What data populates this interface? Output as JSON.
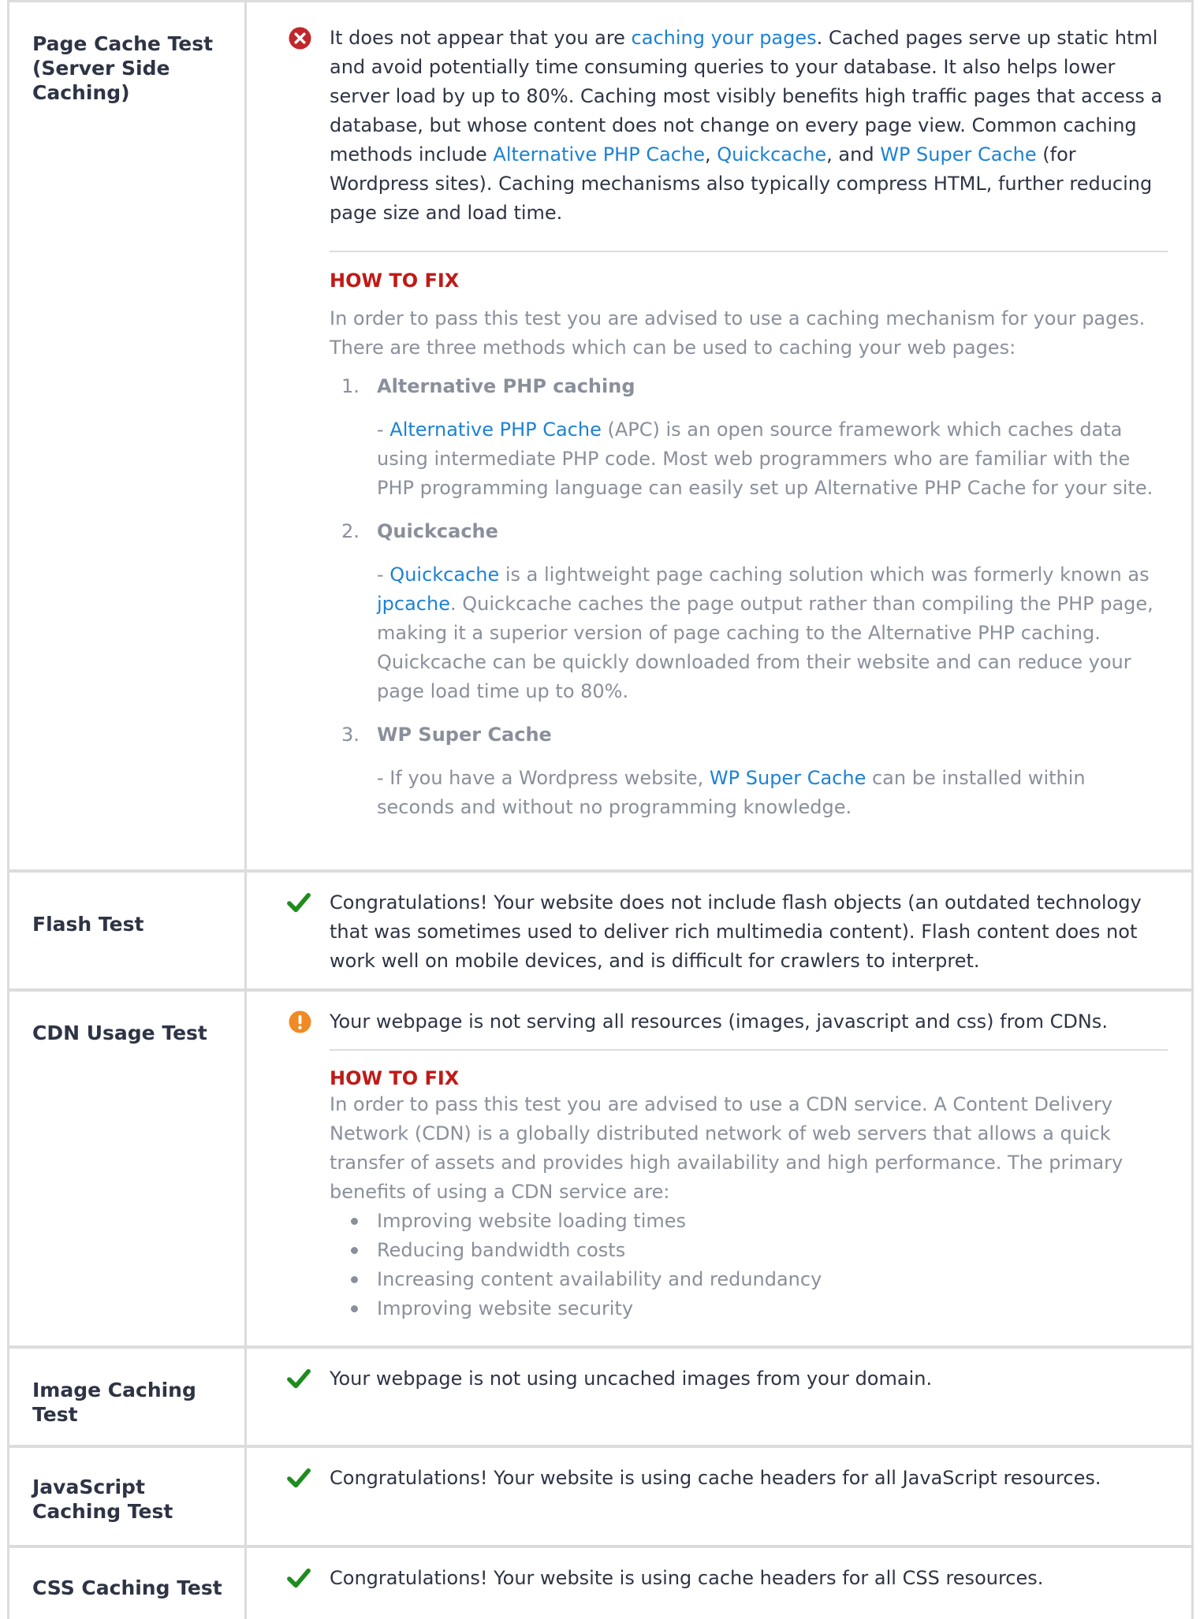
{
  "rows": [
    {
      "label": "Page Cache Test (Server Side Caching)",
      "status": "fail",
      "message": {
        "p1": "It does not appear that you are ",
        "link1": "caching your pages",
        "p2": ". Cached pages serve up static html and avoid potentially time consuming queries to your database. It also helps lower server load by up to 80%. Caching most visibly benefits high traffic pages that access a database, but whose content does not change on every page view. Common caching methods include ",
        "link2": "Alternative PHP Cache",
        "p3": ", ",
        "link3": "Quickcache",
        "p4": ", and ",
        "link4": "WP Super Cache",
        "p5": " (for Wordpress sites). Caching mechanisms also typically compress HTML, further reducing page size and load time."
      },
      "how_to_fix": {
        "heading": "HOW TO FIX",
        "intro": "In order to pass this test you are advised to use a caching mechanism for your pages. There are three methods which can be used to caching your web pages:",
        "methods": [
          {
            "number": "1.",
            "title": "Alternative PHP caching",
            "prefix": "- ",
            "link": "Alternative PHP Cache",
            "text": " (APC) is an open source framework which caches data using intermediate PHP code. Most web programmers who are familiar with the PHP programming language can easily set up Alternative PHP Cache for your site."
          },
          {
            "number": "2.",
            "title": "Quickcache",
            "prefix": "- ",
            "link": "Quickcache",
            "mid": " is a lightweight page caching solution which was formerly known as ",
            "link2": "jpcache",
            "text": ". Quickcache caches the page output rather than compiling the PHP page, making it a superior version of page caching to the Alternative PHP caching. Quickcache can be quickly downloaded from their website and can reduce your page load time up to 80%."
          },
          {
            "number": "3.",
            "title": "WP Super Cache",
            "prefix": "- If you have a Wordpress website, ",
            "link": "WP Super Cache",
            "text": " can be installed within seconds and without no programming knowledge."
          }
        ]
      }
    },
    {
      "label": "Flash Test",
      "status": "pass",
      "message": "Congratulations! Your website does not include flash objects (an outdated technology that was sometimes used to deliver rich multimedia content). Flash content does not work well on mobile devices, and is difficult for crawlers to interpret."
    },
    {
      "label": "CDN Usage Test",
      "status": "warning",
      "message": "Your webpage is not serving all resources (images, javascript and css) from CDNs.",
      "how_to_fix": {
        "heading": "HOW TO FIX",
        "intro": "In order to pass this test you are advised to use a CDN service. A Content Delivery Network (CDN) is a globally distributed network of web servers that allows a quick transfer of assets and provides high availability and high performance. The primary benefits of using a CDN service are:",
        "bullets": [
          "Improving website loading times",
          "Reducing bandwidth costs",
          "Increasing content availability and redundancy",
          "Improving website security"
        ]
      }
    },
    {
      "label": "Image Caching Test",
      "status": "pass",
      "message": "Your webpage is not using uncached images from your domain."
    },
    {
      "label": "JavaScript Caching Test",
      "status": "pass",
      "message": "Congratulations! Your website is using cache headers for all JavaScript resources."
    },
    {
      "label": "CSS Caching Test",
      "status": "pass",
      "message": "Congratulations! Your website is using cache headers for all CSS resources."
    }
  ],
  "colors": {
    "fail": "#c0262c",
    "pass": "#1e8c1e",
    "warning": "#f08a24",
    "link": "#1d82d3",
    "how_to_fix": "#c01a17"
  },
  "icons": {
    "fail": "x-circle-icon",
    "pass": "check-icon",
    "warning": "exclamation-circle-icon"
  }
}
